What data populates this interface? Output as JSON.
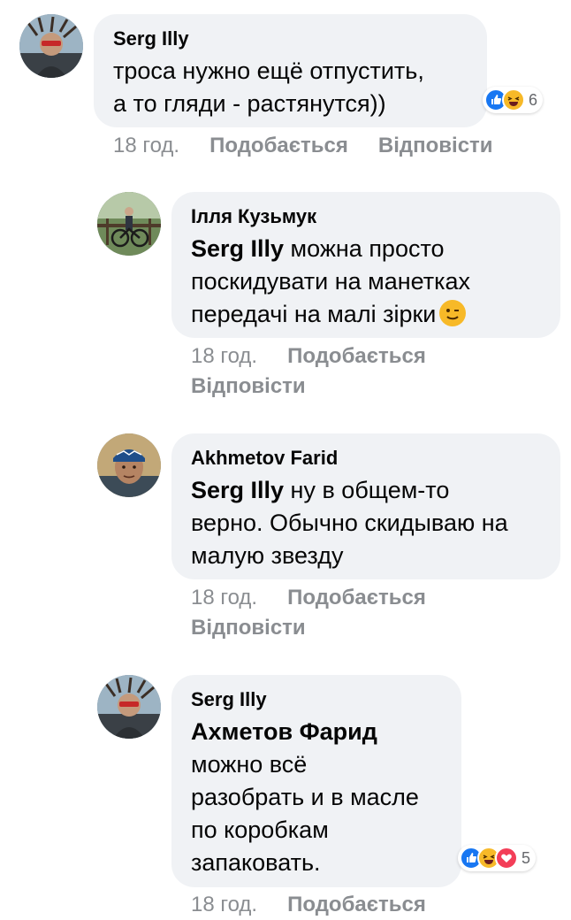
{
  "comments": [
    {
      "author": "Serg Illy",
      "text_line1": "троса нужно ещё отпустить,",
      "text_line2": "а то гляди - растянутся))",
      "time": "18 год.",
      "like_label": "Подобається",
      "reply_label": "Відповісти",
      "reaction_icons": [
        "like-icon",
        "haha-icon"
      ],
      "reaction_count": "6"
    },
    {
      "author": "Ілля Кузьмук",
      "mention": "Serg Illy",
      "text_rest1": " можна просто",
      "text_line2": "поскидувати на манетках",
      "text_line3": "передачі на малі зірки",
      "emoji": "wink-emoji",
      "time": "18 год.",
      "like_label": "Подобається",
      "reply_label": "Відповісти"
    },
    {
      "author": "Akhmetov  Farid",
      "mention": "Serg Illy",
      "text_rest1": " ну в общем-то",
      "text_line2": "верно. Обычно скидываю на",
      "text_line3": "малую звезду",
      "time": "18 год.",
      "like_label": "Подобається",
      "reply_label": "Відповісти"
    },
    {
      "author": "Serg Illy",
      "mention": "Ахметов Фарид",
      "text_line2": "можно всё",
      "text_line3": "разобрать и в масле",
      "text_line4": "по коробкам",
      "text_line5": "запаковать.",
      "time": "18 год.",
      "like_label": "Подобається",
      "reaction_icons": [
        "like-icon",
        "haha-icon",
        "love-icon"
      ],
      "reaction_count": "5"
    }
  ],
  "colors": {
    "bubble": "#f0f2f5",
    "meta_text": "#8a8d91",
    "like_blue": "#1877f2",
    "haha_yellow": "#f7b928",
    "love_red": "#f33e58"
  }
}
